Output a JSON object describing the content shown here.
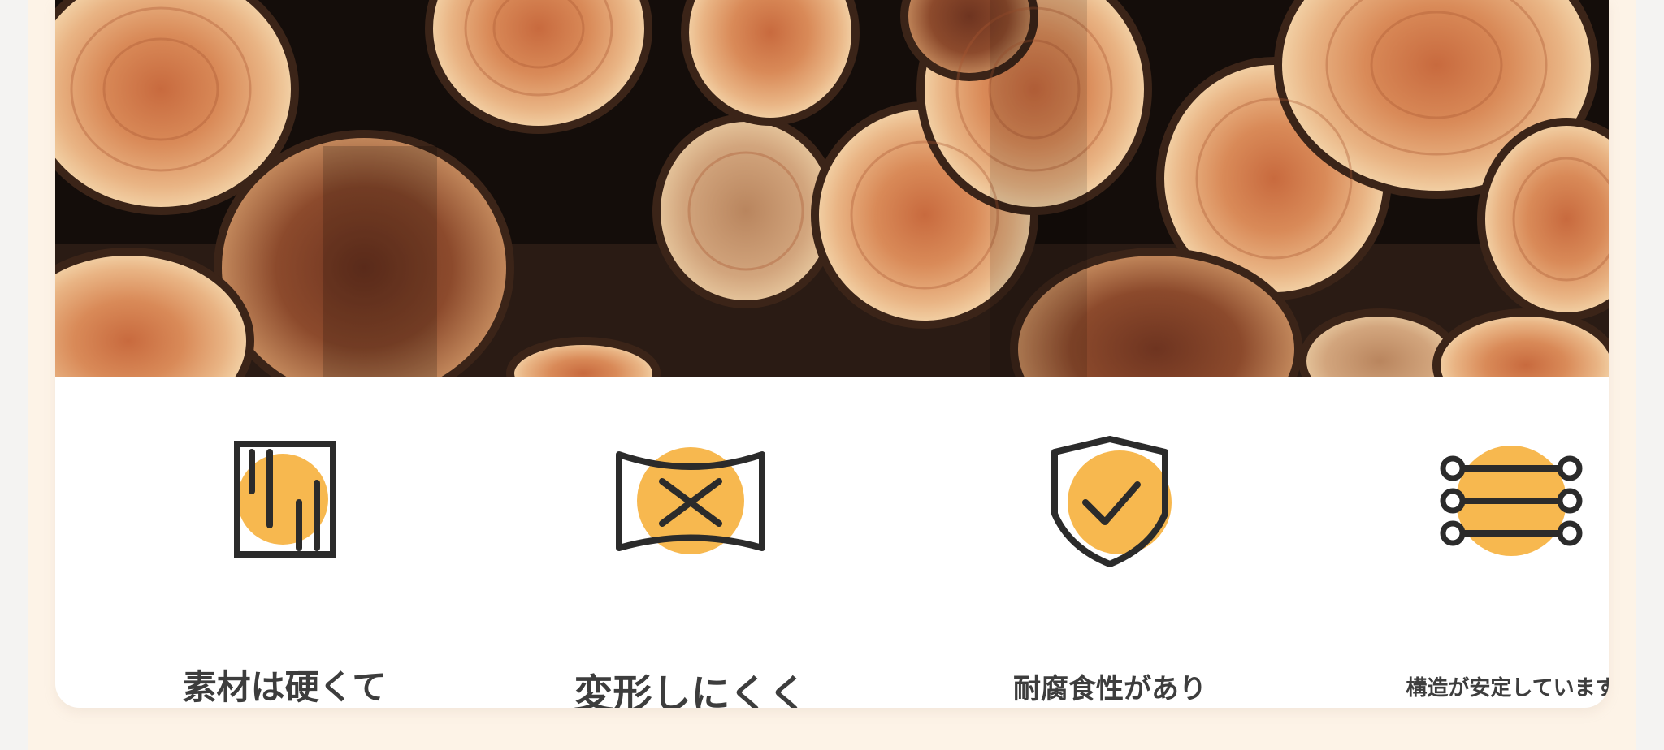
{
  "hero": {
    "image_name": "stacked-log-ends-photo"
  },
  "features": [
    {
      "icon": "wood-grain-board-icon",
      "label": "素材は硬くて"
    },
    {
      "icon": "warp-cross-icon",
      "label": "変形しにくく"
    },
    {
      "icon": "shield-check-icon",
      "label": "耐腐食性があり"
    },
    {
      "icon": "ladder-structure-icon",
      "label": "構造が安定しています"
    }
  ],
  "colors": {
    "accent": "#f7b84f",
    "icon_stroke": "#2b2b2b",
    "text": "#3d3d3d",
    "panel_bg": "#fdf3e7"
  }
}
